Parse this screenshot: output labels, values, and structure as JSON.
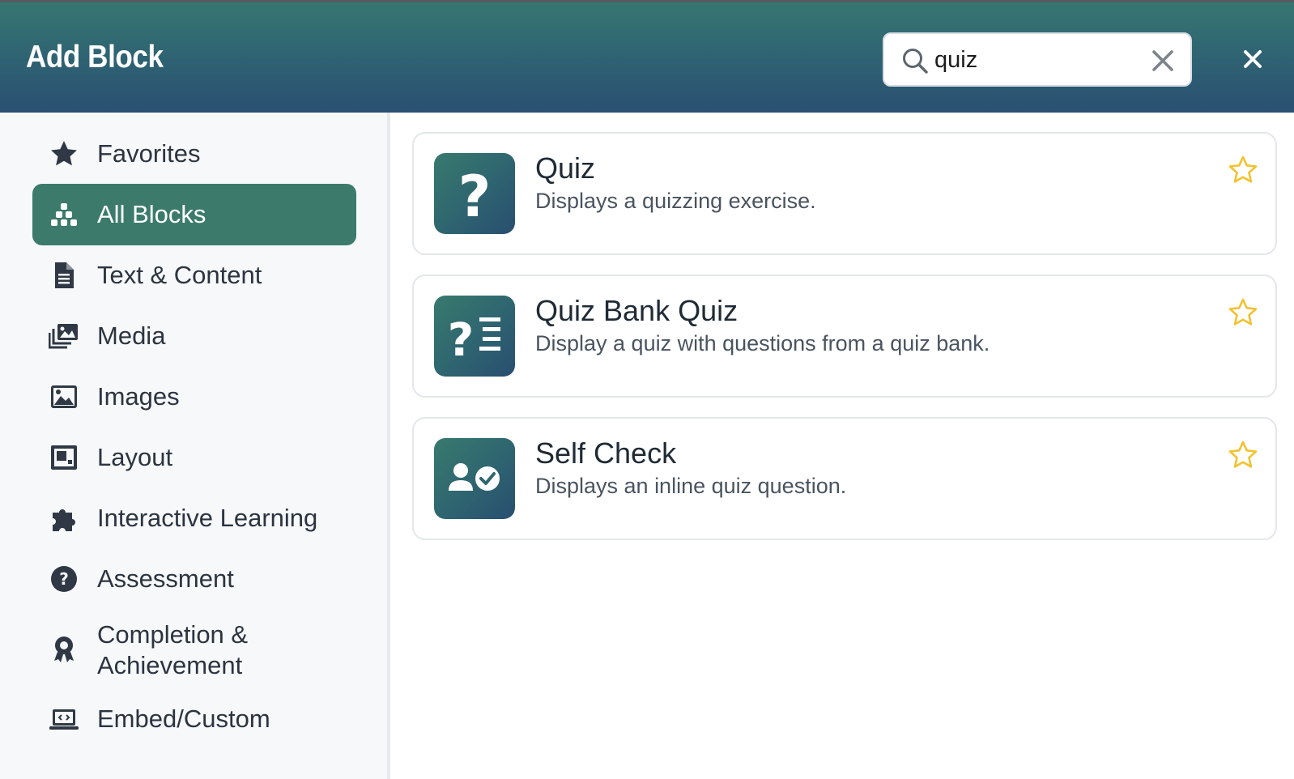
{
  "dialog": {
    "title": "Add Block"
  },
  "search": {
    "value": "quiz",
    "placeholder": "Search"
  },
  "sidebar": {
    "items": [
      {
        "label": "Favorites",
        "icon": "star-icon"
      },
      {
        "label": "All Blocks",
        "icon": "blocks-icon",
        "active": true
      },
      {
        "label": "Text & Content",
        "icon": "document-icon"
      },
      {
        "label": "Media",
        "icon": "media-icon"
      },
      {
        "label": "Images",
        "icon": "image-icon"
      },
      {
        "label": "Layout",
        "icon": "layout-icon"
      },
      {
        "label": "Interactive Learning",
        "icon": "puzzle-icon"
      },
      {
        "label": "Assessment",
        "icon": "question-circle-icon"
      },
      {
        "label": "Completion & Achievement",
        "icon": "award-icon"
      },
      {
        "label": "Embed/Custom",
        "icon": "code-laptop-icon"
      }
    ]
  },
  "results": [
    {
      "title": "Quiz",
      "description": "Displays a quizzing exercise.",
      "icon": "question-mark-icon"
    },
    {
      "title": "Quiz Bank Quiz",
      "description": "Display a quiz with questions from a quiz bank.",
      "icon": "question-list-icon"
    },
    {
      "title": "Self Check",
      "description": "Displays an inline quiz question.",
      "icon": "user-check-icon"
    }
  ],
  "colors": {
    "header_start": "#377671",
    "header_end": "#2a4f72",
    "active_nav": "#3c7b6c",
    "star": "#f2c230",
    "sidebar_bg": "#f6f8fa"
  }
}
